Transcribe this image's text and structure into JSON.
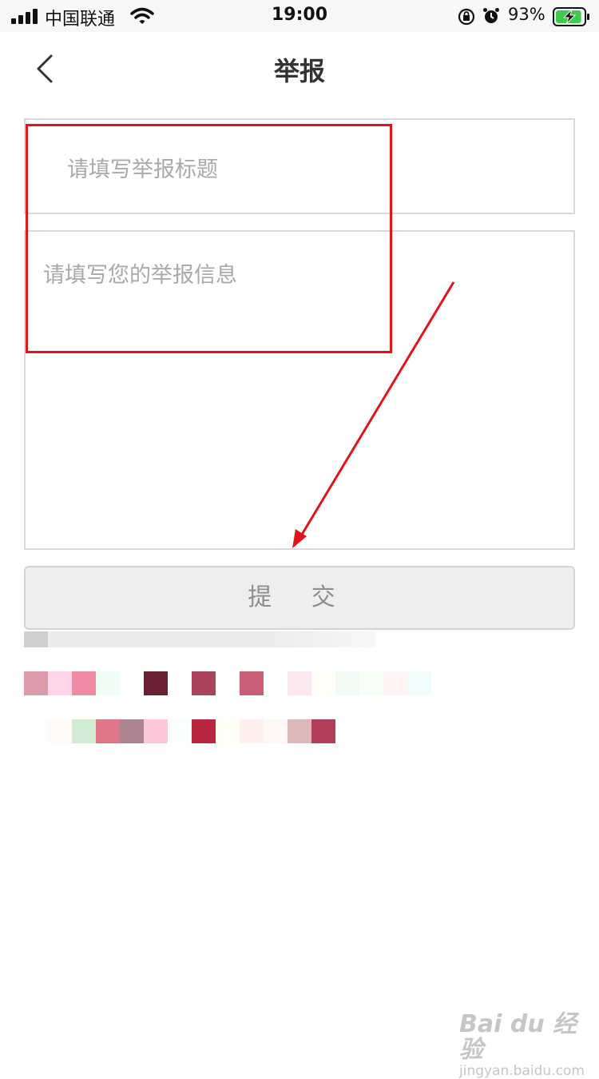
{
  "status_bar": {
    "carrier": "中国联通",
    "time": "19:00",
    "battery_percent": "93%",
    "battery_level": 0.93,
    "icons": [
      "signal-icon",
      "wifi-icon",
      "rotation-lock-icon",
      "alarm-icon",
      "battery-charging-icon"
    ]
  },
  "nav": {
    "back_icon": "chevron-left-icon",
    "title": "举报"
  },
  "form": {
    "title_placeholder": "请填写举报标题",
    "title_value": "",
    "info_placeholder": "请填写您的举报信息",
    "info_value": "",
    "submit_label": "提 交"
  },
  "colors": {
    "annotation_red": "#e0141c",
    "border_gray": "#d8d8d8",
    "placeholder_gray": "#a9a9a9",
    "button_bg": "#eeeeee"
  },
  "blurred_pixels": {
    "row1": [
      "#dd9aab",
      "#fdd5e8",
      "#ef8ca4",
      "#eefef4",
      "#ffffff",
      "#6b1f33",
      "#ffffff",
      "#a9445b",
      "#ffffff",
      "#c85f75",
      "#ffffff",
      "#fbe7f0",
      "#fffff8",
      "#f1fbf3",
      "#f7fff6",
      "#fff3f3",
      "#f0fdfd"
    ],
    "row2": [
      "#fffdfd",
      "#fffbf6",
      "#d2ebd5",
      "#e17689",
      "#ad8390",
      "#fdc7da",
      "#fafffe",
      "#b82640",
      "#fffff5",
      "#fff0ed",
      "#fff6f6",
      "#dcb8b8",
      "#b13f59"
    ]
  },
  "watermark": {
    "logo": "Bai du 经验",
    "url": "jingyan.baidu.com"
  }
}
